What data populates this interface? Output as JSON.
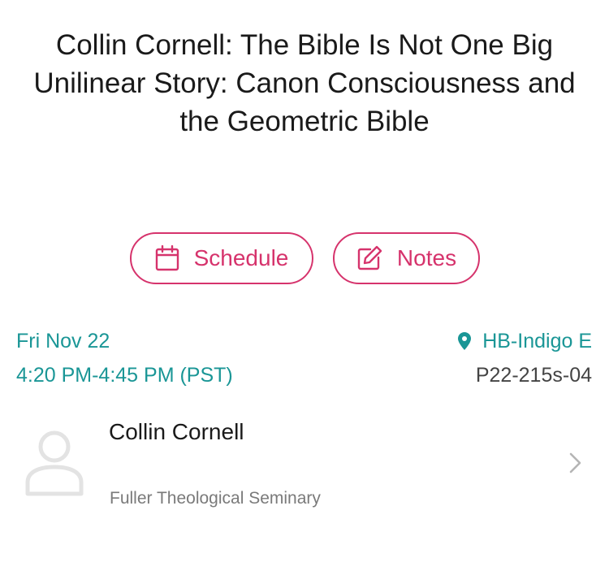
{
  "session": {
    "title": "Collin Cornell: The Bible Is Not One Big Unilinear Story: Canon Consciousness and the Geometric Bible",
    "date": "Fri Nov 22",
    "time": "4:20 PM-4:45 PM (PST)",
    "room": "HB-Indigo E",
    "code": "P22-215s-04"
  },
  "actions": {
    "schedule_label": "Schedule",
    "notes_label": "Notes"
  },
  "speaker": {
    "name": "Collin Cornell",
    "affiliation": "Fuller Theological Seminary"
  },
  "icons": {
    "schedule": "calendar-icon",
    "notes": "edit-note-icon",
    "room": "location-pin-icon",
    "avatar": "person-placeholder-icon",
    "row": "chevron-right-icon"
  },
  "colors": {
    "accent": "#d6336c",
    "teal": "#1a9696",
    "muted": "#7a7a7a"
  }
}
